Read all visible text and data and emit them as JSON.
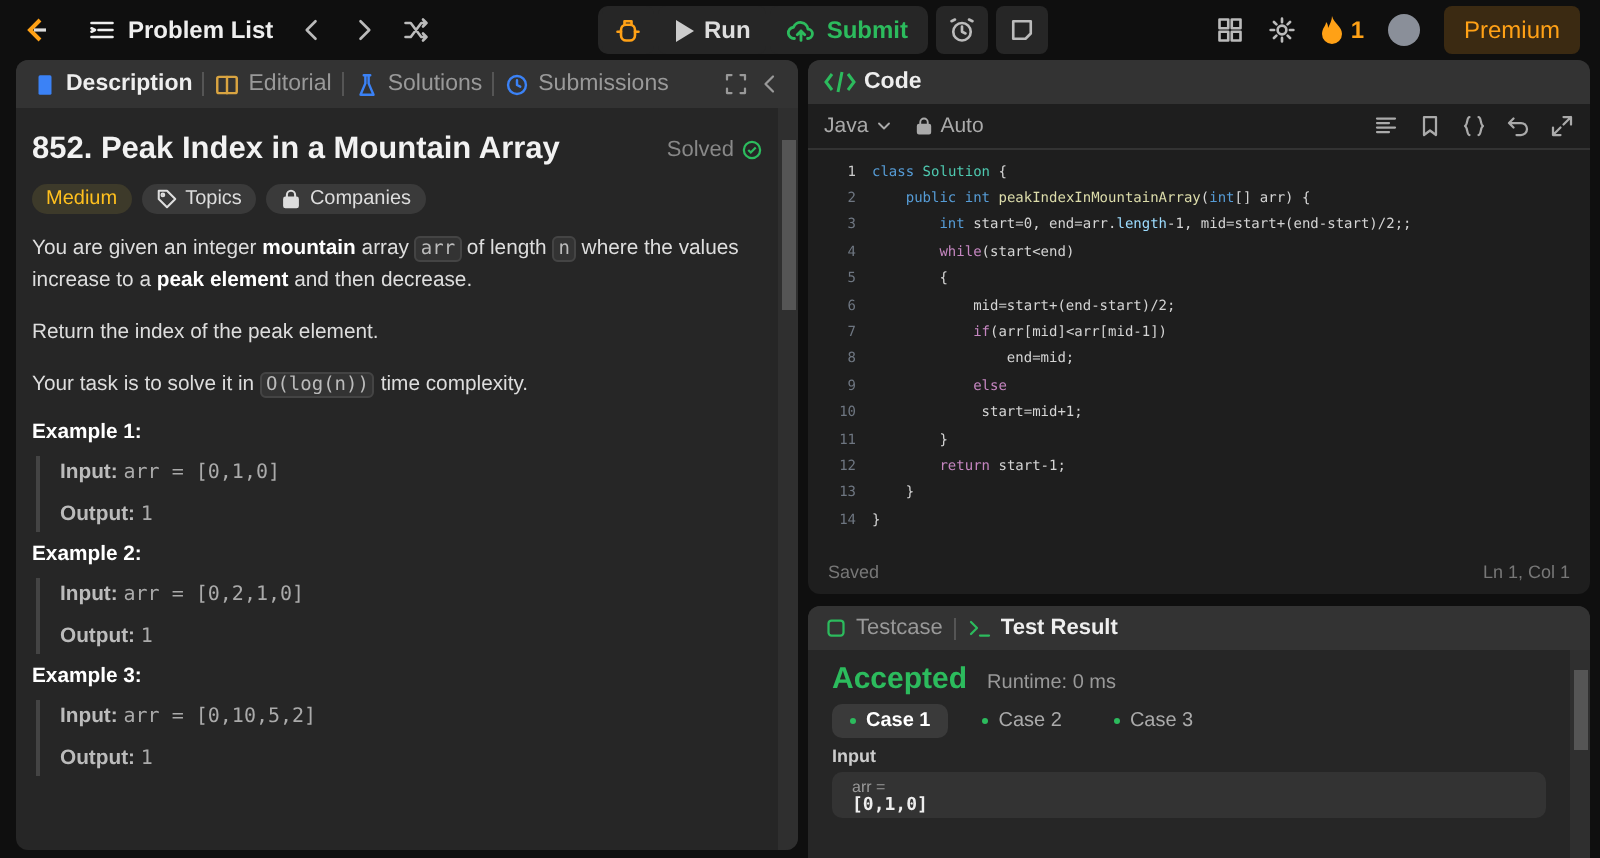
{
  "top_bar": {
    "problem_list": "Problem List",
    "run": "Run",
    "submit": "Submit",
    "streak": "1",
    "premium": "Premium"
  },
  "description": {
    "tabs": [
      {
        "label": "Description",
        "selected": true
      },
      {
        "label": "Editorial",
        "selected": false
      },
      {
        "label": "Solutions",
        "selected": false
      },
      {
        "label": "Submissions",
        "selected": false
      }
    ],
    "title": "852. Peak Index in a Mountain Array",
    "status": "Solved",
    "difficulty": "Medium",
    "tags": [
      {
        "label": "Topics",
        "kind": "topics"
      },
      {
        "label": "Companies",
        "kind": "companies"
      }
    ],
    "paragraphs": [
      [
        {
          "kind": "text",
          "text": "You are given an integer **mountain** array "
        },
        {
          "kind": "code",
          "text": "arr"
        },
        {
          "kind": "text",
          "text": " of length "
        },
        {
          "kind": "code",
          "text": "n"
        },
        {
          "kind": "text",
          "text": " where the values increase to a **peak element** and then decrease."
        }
      ],
      [
        {
          "kind": "text",
          "text": "Return the index of the peak element."
        }
      ],
      [
        {
          "kind": "text",
          "text": "Your task is to solve it in "
        },
        {
          "kind": "code",
          "text": "O(log(n))"
        },
        {
          "kind": "text",
          "text": " time complexity."
        }
      ]
    ],
    "examples": [
      {
        "title": "Example 1:",
        "input_label": "Input:",
        "input": "arr = [0,1,0]",
        "output_label": "Output:",
        "output": "1"
      },
      {
        "title": "Example 2:",
        "input_label": "Input:",
        "input": "arr = [0,2,1,0]",
        "output_label": "Output:",
        "output": "1"
      },
      {
        "title": "Example 3:",
        "input_label": "Input:",
        "input": "arr = [0,10,5,2]",
        "output_label": "Output:",
        "output": "1"
      }
    ]
  },
  "code": {
    "title": "Code",
    "language": "Java",
    "mode": "Auto",
    "lines": [
      {
        "number": "1",
        "tokens": [
          {
            "kind": "keyword",
            "text": "class"
          },
          {
            "kind": "type",
            "text": "Solution"
          },
          {
            "kind": "plain",
            "text": "{"
          }
        ]
      },
      {
        "number": "2",
        "tokens": [
          {
            "kind": "keyword",
            "text": "    public int"
          },
          {
            "kind": "function",
            "text": "peakIndexInMountainArray"
          },
          {
            "kind": "plain",
            "text": "("
          },
          {
            "kind": "keyword",
            "text": "int"
          },
          {
            "kind": "plain",
            "text": "[] arr) {"
          }
        ]
      },
      {
        "number": "3",
        "tokens": [
          {
            "kind": "keyword",
            "text": "        int"
          },
          {
            "kind": "plain",
            "text": "start=0, end=arr."
          },
          {
            "kind": "property",
            "text": "length"
          },
          {
            "kind": "plain",
            "text": "-1, mid=start+(end-start)/2;;"
          }
        ]
      },
      {
        "number": "4",
        "tokens": [
          {
            "kind": "control",
            "text": "        while"
          },
          {
            "kind": "plain",
            "text": "(start<end)"
          }
        ]
      },
      {
        "number": "5",
        "tokens": [
          {
            "kind": "plain",
            "text": "        {"
          }
        ]
      },
      {
        "number": "6",
        "tokens": [
          {
            "kind": "plain",
            "text": "            mid=start+(end-start)/2;"
          }
        ]
      },
      {
        "number": "7",
        "tokens": [
          {
            "kind": "control",
            "text": "            if"
          },
          {
            "kind": "plain",
            "text": "(arr[mid]<arr[mid-1])"
          }
        ]
      },
      {
        "number": "8",
        "tokens": [
          {
            "kind": "plain",
            "text": "                end=mid;"
          }
        ]
      },
      {
        "number": "9",
        "tokens": [
          {
            "kind": "control",
            "text": "            else"
          }
        ]
      },
      {
        "number": "10",
        "tokens": [
          {
            "kind": "plain",
            "text": "             start=mid+1;"
          }
        ]
      },
      {
        "number": "11",
        "tokens": [
          {
            "kind": "plain",
            "text": "        }"
          }
        ]
      },
      {
        "number": "12",
        "tokens": [
          {
            "kind": "control",
            "text": "        return"
          },
          {
            "kind": "plain",
            "text": "start-1;"
          }
        ]
      },
      {
        "number": "13",
        "tokens": [
          {
            "kind": "plain",
            "text": "    }"
          }
        ]
      },
      {
        "number": "14",
        "tokens": [
          {
            "kind": "plain",
            "text": "}"
          }
        ]
      }
    ],
    "status": "Saved",
    "cursor": "Ln 1, Col 1"
  },
  "result": {
    "tabs": [
      {
        "label": "Testcase",
        "selected": false
      },
      {
        "label": "Test Result",
        "selected": true
      }
    ],
    "verdict": "Accepted",
    "runtime": "Runtime: 0 ms",
    "cases": [
      {
        "label": "Case 1",
        "selected": true,
        "passed": true
      },
      {
        "label": "Case 2",
        "selected": false,
        "passed": true
      },
      {
        "label": "Case 3",
        "selected": false,
        "passed": true
      }
    ],
    "input_label": "Input",
    "params": [
      {
        "name": "arr =",
        "value": "[0,1,0]"
      }
    ]
  }
}
